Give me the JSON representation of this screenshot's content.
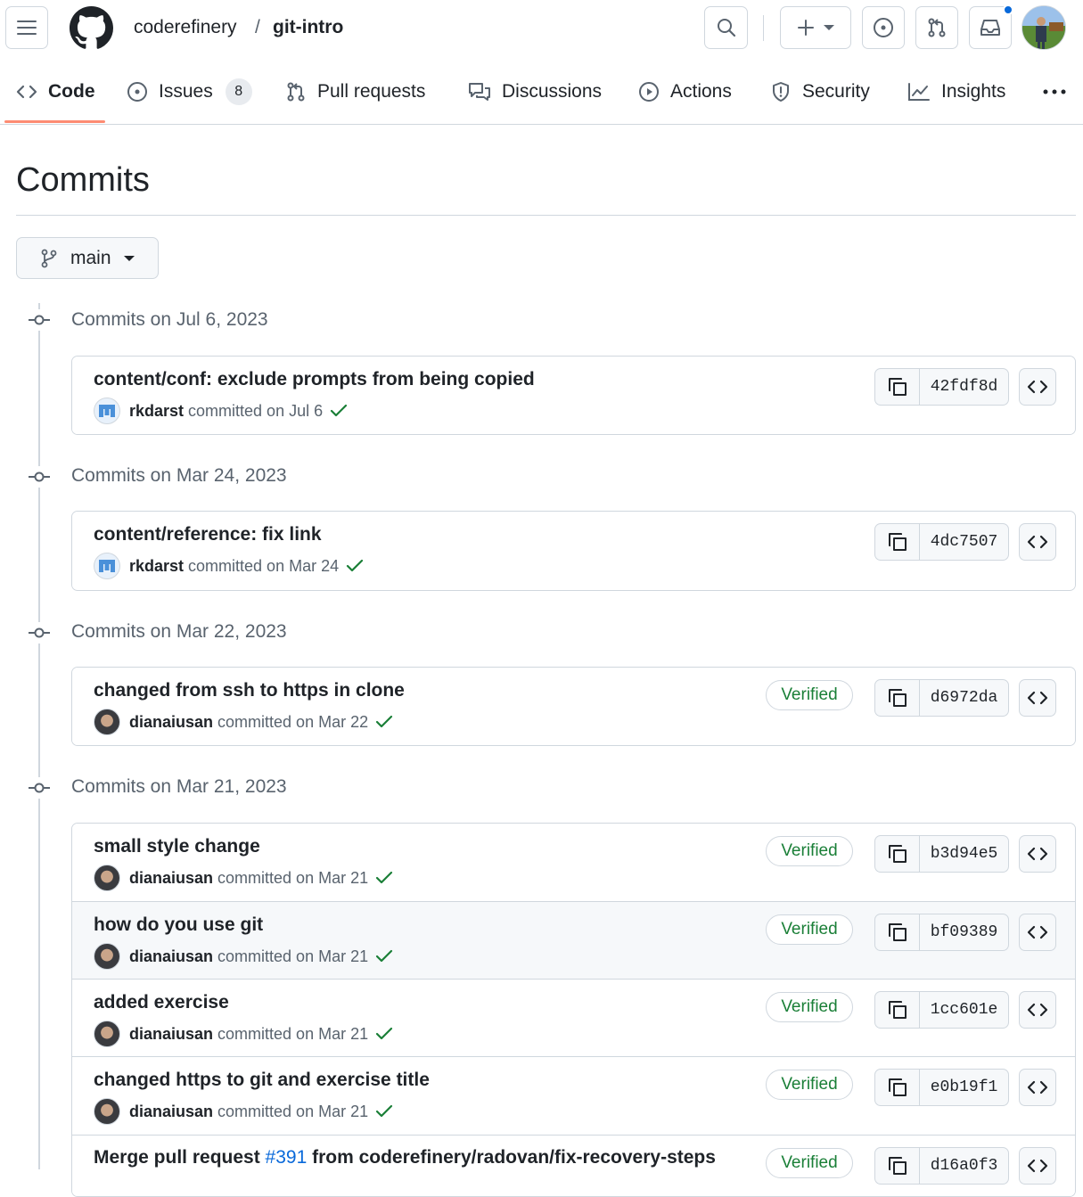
{
  "header": {
    "owner": "coderefinery",
    "separator": "/",
    "repo": "git-intro"
  },
  "nav": {
    "tabs": [
      {
        "label": "Code",
        "icon": "code-icon",
        "selected": true
      },
      {
        "label": "Issues",
        "icon": "issue-opened-icon",
        "count": "8"
      },
      {
        "label": "Pull requests",
        "icon": "git-pull-request-icon"
      },
      {
        "label": "Discussions",
        "icon": "comment-discussion-icon"
      },
      {
        "label": "Actions",
        "icon": "play-icon"
      },
      {
        "label": "Security",
        "icon": "shield-icon"
      },
      {
        "label": "Insights",
        "icon": "graph-icon"
      }
    ]
  },
  "page": {
    "title": "Commits",
    "branch": "main"
  },
  "groups": [
    {
      "title": "Commits on Jul 6, 2023",
      "commits": [
        {
          "message": "content/conf: exclude prompts from being copied",
          "author": "rkdarst",
          "meta": "committed on Jul 6",
          "verified": "",
          "sha": "42fdf8d",
          "avatar": "rkdarst-avatar"
        }
      ]
    },
    {
      "title": "Commits on Mar 24, 2023",
      "commits": [
        {
          "message": "content/reference: fix link",
          "author": "rkdarst",
          "meta": "committed on Mar 24",
          "verified": "",
          "sha": "4dc7507",
          "avatar": "rkdarst-avatar"
        }
      ]
    },
    {
      "title": "Commits on Mar 22, 2023",
      "commits": [
        {
          "message": "changed from ssh to https in clone",
          "author": "dianaiusan",
          "meta": "committed on Mar 22",
          "verified": "Verified",
          "sha": "d6972da",
          "avatar": "dianaiusan-avatar"
        }
      ]
    },
    {
      "title": "Commits on Mar 21, 2023",
      "commits": [
        {
          "message": "small style change",
          "author": "dianaiusan",
          "meta": "committed on Mar 21",
          "verified": "Verified",
          "sha": "b3d94e5",
          "avatar": "dianaiusan-avatar"
        },
        {
          "message": "how do you use git",
          "author": "dianaiusan",
          "meta": "committed on Mar 21",
          "verified": "Verified",
          "sha": "bf09389",
          "avatar": "dianaiusan-avatar"
        },
        {
          "message": "added exercise",
          "author": "dianaiusan",
          "meta": "committed on Mar 21",
          "verified": "Verified",
          "sha": "1cc601e",
          "avatar": "dianaiusan-avatar"
        },
        {
          "message": "changed https to git and exercise title",
          "author": "dianaiusan",
          "meta": "committed on Mar 21",
          "verified": "Verified",
          "sha": "e0b19f1",
          "avatar": "dianaiusan-avatar"
        },
        {
          "message_prefix": "Merge pull request ",
          "message_link": "#391",
          "message_suffix": " from coderefinery/radovan/fix-recovery-steps",
          "verified": "Verified",
          "sha": "d16a0f3"
        }
      ]
    }
  ],
  "colors": {
    "accent_underline": "#fd8c73",
    "verified_green": "#1a7f37",
    "link_blue": "#0969da",
    "notification_dot": "#0969da"
  }
}
